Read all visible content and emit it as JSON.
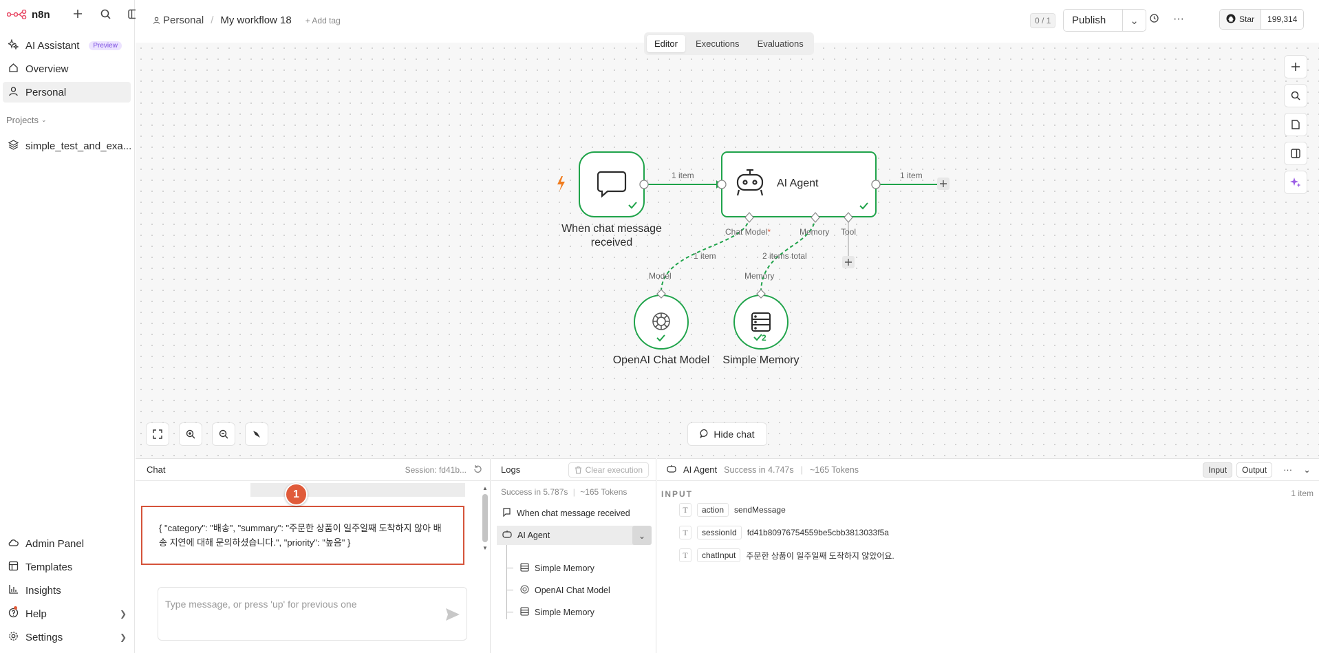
{
  "app": {
    "logo_text": "n8n"
  },
  "sidebar": {
    "items": [
      {
        "label": "AI Assistant",
        "badge": "Preview",
        "icon": "sparkle-icon"
      },
      {
        "label": "Overview",
        "icon": "home-icon"
      },
      {
        "label": "Personal",
        "icon": "user-icon"
      }
    ],
    "projects_label": "Projects",
    "project_items": [
      {
        "label": "simple_test_and_exa...",
        "icon": "layers-icon"
      }
    ],
    "bottom_items": [
      {
        "label": "Admin Panel",
        "icon": "cloud-icon"
      },
      {
        "label": "Templates",
        "icon": "templates-icon"
      },
      {
        "label": "Insights",
        "icon": "chart-icon"
      },
      {
        "label": "Help",
        "icon": "help-icon"
      },
      {
        "label": "Settings",
        "icon": "gear-icon"
      }
    ]
  },
  "header": {
    "breadcrumb_project": "Personal",
    "breadcrumb_separator": "/",
    "workflow_name": "My workflow 18",
    "add_tag": "+ Add tag",
    "counter": "0 / 1",
    "publish_label": "Publish",
    "github_star": "Star",
    "github_count": "199,314"
  },
  "tabs": [
    "Editor",
    "Executions",
    "Evaluations"
  ],
  "canvas": {
    "nodes": {
      "trigger_label": "When chat message received",
      "agent_label": "AI Agent",
      "openai_label": "OpenAI Chat Model",
      "memory_label": "Simple Memory",
      "memory_badge": "2"
    },
    "connections": {
      "trigger_to_agent": "1 item",
      "agent_out": "1 item",
      "chat_model_port": "Chat Model",
      "memory_port": "Memory",
      "tool_port": "Tool",
      "model_items": "1 item",
      "memory_items": "2 items total",
      "model_input": "Model",
      "memory_input": "Memory"
    },
    "hide_chat": "Hide chat"
  },
  "chat": {
    "title": "Chat",
    "session": "Session: fd41b...",
    "badge": "1",
    "message": "{ \"category\": \"배송\", \"summary\": \"주문한 상품이 일주일째 도착하지 않아 배송 지연에 대해 문의하셨습니다.\", \"priority\": \"높음\" }",
    "input_placeholder": "Type message, or press 'up' for previous one"
  },
  "logs": {
    "title": "Logs",
    "clear_label": "Clear execution",
    "summary_status": "Success in 5.787s",
    "summary_tokens": "~165 Tokens",
    "entries": [
      {
        "label": "When chat message received",
        "icon": "chat-icon"
      },
      {
        "label": "AI Agent",
        "icon": "robot-icon"
      },
      {
        "label": "Simple Memory",
        "icon": "database-icon"
      },
      {
        "label": "OpenAI Chat Model",
        "icon": "openai-icon"
      },
      {
        "label": "Simple Memory",
        "icon": "database-icon"
      }
    ]
  },
  "io": {
    "node_name": "AI Agent",
    "status": "Success in 4.747s",
    "tokens": "~165 Tokens",
    "input_btn": "Input",
    "output_btn": "Output",
    "section_label": "INPUT",
    "item_count": "1 item",
    "fields": [
      {
        "key": "action",
        "value": "sendMessage"
      },
      {
        "key": "sessionId",
        "value": "fd41b80976754559be5cbb3813033f5a"
      },
      {
        "key": "chatInput",
        "value": "주문한 상품이 일주일째 도착하지 않았어요."
      }
    ]
  },
  "colors": {
    "success": "#1fa34a",
    "accent_orange": "#f07b1d",
    "highlight": "#d5533a"
  }
}
